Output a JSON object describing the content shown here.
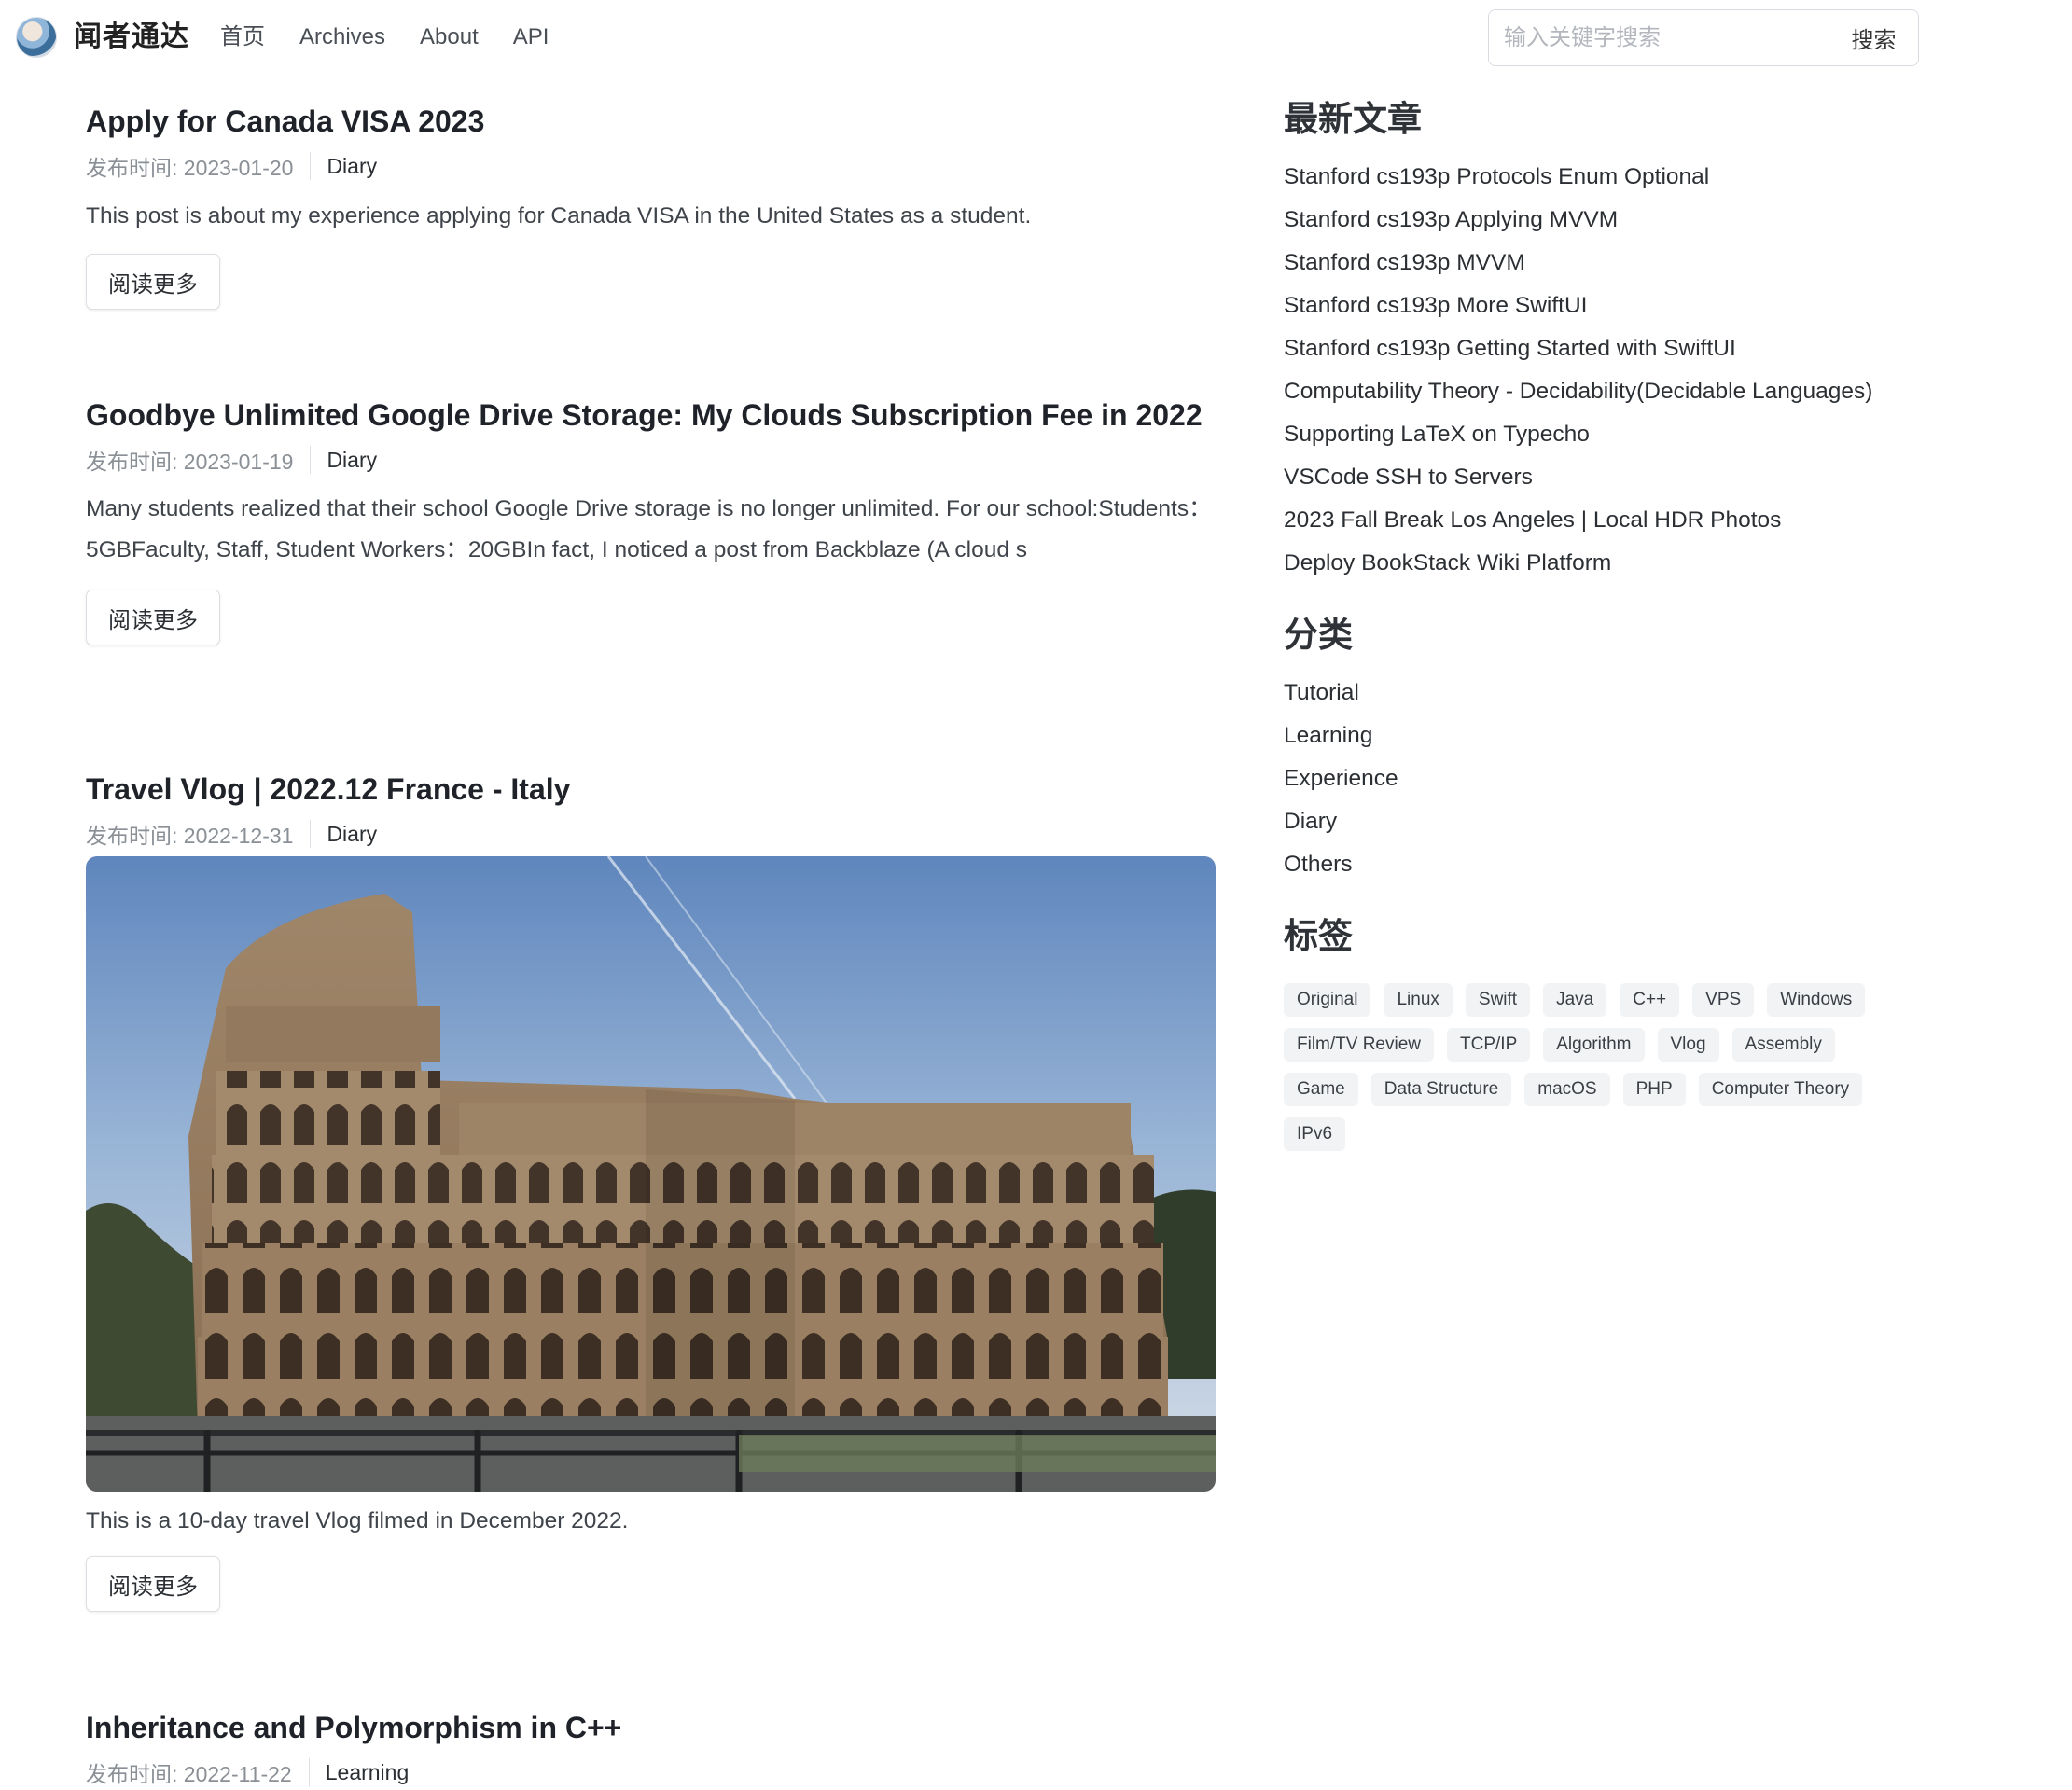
{
  "site": {
    "name": "闻者通达",
    "nav": [
      "首页",
      "Archives",
      "About",
      "API"
    ],
    "search_placeholder": "输入关键字搜索",
    "search_button": "搜索"
  },
  "posts": [
    {
      "title": "Apply for Canada VISA 2023",
      "date": "发布时间: 2023-01-20",
      "category": "Diary",
      "excerpt": "This post is about my experience applying for Canada VISA in the United States as a student.",
      "read_more": "阅读更多"
    },
    {
      "title": "Goodbye Unlimited Google Drive Storage: My Clouds Subscription Fee in 2022",
      "date": "发布时间: 2023-01-19",
      "category": "Diary",
      "excerpt": "Many students realized that their school Google Drive storage is no longer unlimited. For our school:Students：5GBFaculty, Staff, Student Workers：20GBIn fact, I noticed a post from Backblaze (A cloud s",
      "read_more": "阅读更多"
    },
    {
      "title": "Travel Vlog | 2022.12 France - Italy",
      "date": "发布时间: 2022-12-31",
      "category": "Diary",
      "excerpt": "This is a 10-day travel Vlog filmed in December 2022.",
      "read_more": "阅读更多"
    },
    {
      "title": "Inheritance and Polymorphism in C++",
      "date": "发布时间: 2022-11-22",
      "category": "Learning"
    }
  ],
  "sidebar": {
    "recent_title": "最新文章",
    "recent": [
      "Stanford cs193p Protocols Enum Optional",
      "Stanford cs193p Applying MVVM",
      "Stanford cs193p MVVM",
      "Stanford cs193p More SwiftUI",
      "Stanford cs193p Getting Started with SwiftUI",
      "Computability Theory - Decidability(Decidable Languages)",
      "Supporting LaTeX on Typecho",
      "VSCode SSH to Servers",
      "2023 Fall Break Los Angeles | Local HDR Photos",
      "Deploy BookStack Wiki Platform"
    ],
    "categories_title": "分类",
    "categories": [
      "Tutorial",
      "Learning",
      "Experience",
      "Diary",
      "Others"
    ],
    "tags_title": "标签",
    "tags": [
      "Original",
      "Linux",
      "Swift",
      "Java",
      "C++",
      "VPS",
      "Windows",
      "Film/TV Review",
      "TCP/IP",
      "Algorithm",
      "Vlog",
      "Assembly",
      "Game",
      "Data Structure",
      "macOS",
      "PHP",
      "Computer Theory",
      "IPv6"
    ]
  },
  "colors": {
    "tag_bg": "#f2f3f5",
    "meta_gray": "#8a9096",
    "title": "#1f2329"
  },
  "icons": {
    "brand": "avatar-logo"
  }
}
